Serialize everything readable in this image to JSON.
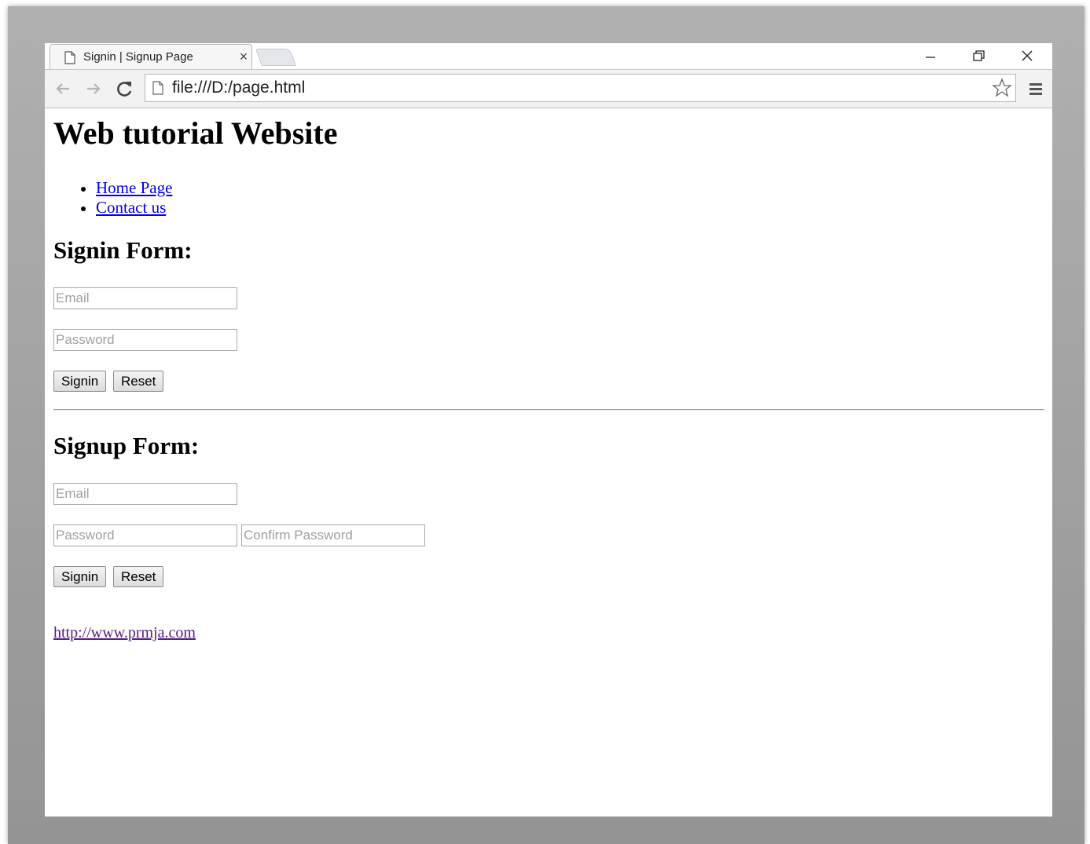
{
  "browser": {
    "tab_title": "Signin | Signup Page",
    "tab_close_glyph": "×",
    "address_url": "file:///D:/page.html",
    "icons": [
      "page-icon",
      "close-icon",
      "minimize-icon",
      "restore-icon",
      "back-arrow-icon",
      "forward-arrow-icon",
      "reload-icon",
      "bookmark-star-icon",
      "menu-icon"
    ]
  },
  "page": {
    "site_title": "Web tutorial Website",
    "nav_links": [
      {
        "label": "Home Page"
      },
      {
        "label": "Contact us"
      }
    ],
    "signin_form": {
      "title": "Signin Form:",
      "email_placeholder": "Email",
      "password_placeholder": "Password",
      "submit_label": "Signin",
      "reset_label": "Reset"
    },
    "signup_form": {
      "title": "Signup Form:",
      "email_placeholder": "Email",
      "password_placeholder": "Password",
      "confirm_password_placeholder": "Confirm Password",
      "submit_label": "Signin",
      "reset_label": "Reset"
    },
    "footer_link": "http://www.prmja.com"
  },
  "colors": {
    "link_unvisited": "#0000ee",
    "link_visited": "#551a8b",
    "placeholder": "#a0a0a0",
    "backdrop_top": "#b0b0b0",
    "backdrop_bottom": "#949494"
  }
}
